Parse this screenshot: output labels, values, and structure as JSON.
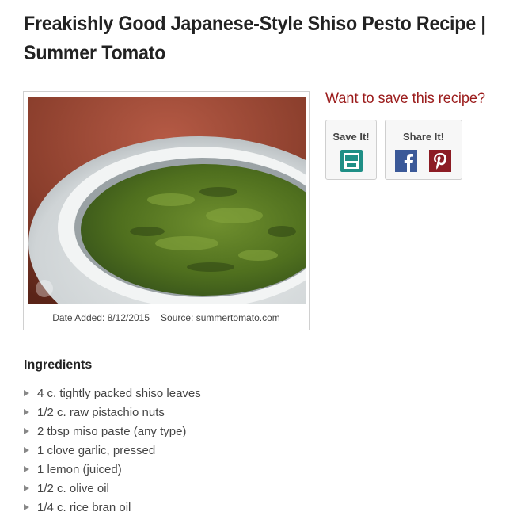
{
  "page": {
    "title": "Freakishly Good Japanese-Style Shiso Pesto Recipe | Summer Tomato"
  },
  "photo": {
    "date_added": "Date Added: 8/12/2015",
    "source": "Source: summertomato.com"
  },
  "save_panel": {
    "heading": "Want to save this recipe?",
    "save_label": "Save It!",
    "share_label": "Share It!",
    "save_icon": "save-floppy-icon",
    "facebook_icon": "facebook-icon",
    "pinterest_icon": "pinterest-icon"
  },
  "ingredients": {
    "heading": "Ingredients",
    "items": [
      "4 c. tightly packed shiso leaves",
      "1/2 c. raw pistachio nuts",
      "2 tbsp miso paste (any type)",
      "1 clove garlic, pressed",
      "1 lemon (juiced)",
      "1/2 c. olive oil",
      "1/4 c. rice bran oil"
    ]
  },
  "colors": {
    "heading_red": "#9b1c1c",
    "save_teal": "#1f8f86",
    "facebook_blue": "#3b5998",
    "pinterest_red": "#8c1c24"
  }
}
